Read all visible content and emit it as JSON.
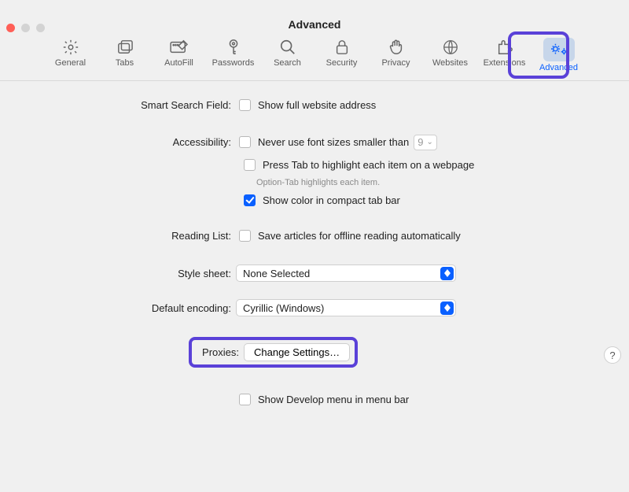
{
  "window": {
    "title": "Advanced"
  },
  "toolbar": {
    "items": [
      {
        "label": "General",
        "icon": "gear"
      },
      {
        "label": "Tabs",
        "icon": "tabs"
      },
      {
        "label": "AutoFill",
        "icon": "autofill"
      },
      {
        "label": "Passwords",
        "icon": "key"
      },
      {
        "label": "Search",
        "icon": "magnifier"
      },
      {
        "label": "Security",
        "icon": "lock"
      },
      {
        "label": "Privacy",
        "icon": "hand"
      },
      {
        "label": "Websites",
        "icon": "globe"
      },
      {
        "label": "Extensions",
        "icon": "puzzle"
      },
      {
        "label": "Advanced",
        "icon": "gears",
        "selected": true
      }
    ]
  },
  "form": {
    "smart_search": {
      "label": "Smart Search Field:",
      "show_full_address": {
        "text": "Show full website address",
        "checked": false
      }
    },
    "accessibility": {
      "label": "Accessibility:",
      "min_font": {
        "text": "Never use font sizes smaller than",
        "value": "9",
        "checked": false
      },
      "press_tab": {
        "text": "Press Tab to highlight each item on a webpage",
        "checked": false
      },
      "hint": "Option-Tab highlights each item.",
      "compact_tab_color": {
        "text": "Show color in compact tab bar",
        "checked": true
      }
    },
    "reading_list": {
      "label": "Reading List:",
      "save_offline": {
        "text": "Save articles for offline reading automatically",
        "checked": false
      }
    },
    "style_sheet": {
      "label": "Style sheet:",
      "value": "None Selected"
    },
    "default_encoding": {
      "label": "Default encoding:",
      "value": "Cyrillic (Windows)"
    },
    "proxies": {
      "label": "Proxies:",
      "button": "Change Settings…"
    },
    "develop_menu": {
      "text": "Show Develop menu in menu bar",
      "checked": false
    }
  },
  "help": "?"
}
